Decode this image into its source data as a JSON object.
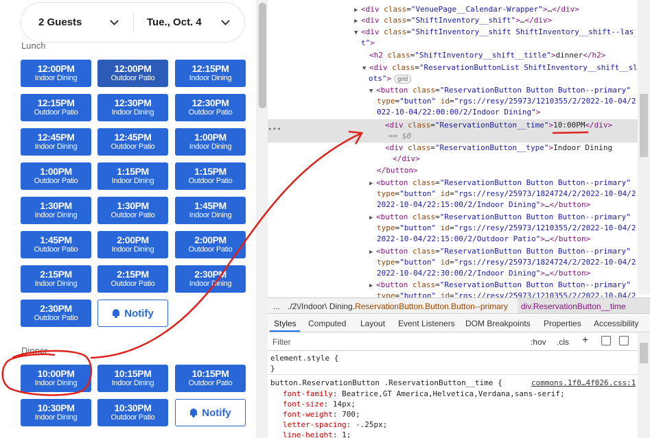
{
  "booking": {
    "guests": "2 Guests",
    "date": "Tue., Oct. 4"
  },
  "lunch": {
    "label": "Lunch",
    "slots": [
      {
        "time": "12:00PM",
        "type": "Indoor Dining"
      },
      {
        "time": "12:00PM",
        "type": "Outdoor Patio"
      },
      {
        "time": "12:15PM",
        "type": "Indoor Dining"
      },
      {
        "time": "12:15PM",
        "type": "Outdoor Patio"
      },
      {
        "time": "12:30PM",
        "type": "Indoor Dining"
      },
      {
        "time": "12:30PM",
        "type": "Outdoor Patio"
      },
      {
        "time": "12:45PM",
        "type": "Indoor Dining"
      },
      {
        "time": "12:45PM",
        "type": "Outdoor Patio"
      },
      {
        "time": "1:00PM",
        "type": "Indoor Dining"
      },
      {
        "time": "1:00PM",
        "type": "Outdoor Patio"
      },
      {
        "time": "1:15PM",
        "type": "Indoor Dining"
      },
      {
        "time": "1:15PM",
        "type": "Outdoor Patio"
      },
      {
        "time": "1:30PM",
        "type": "Indoor Dining"
      },
      {
        "time": "1:30PM",
        "type": "Outdoor Patio"
      },
      {
        "time": "1:45PM",
        "type": "Indoor Dining"
      },
      {
        "time": "1:45PM",
        "type": "Outdoor Patio"
      },
      {
        "time": "2:00PM",
        "type": "Indoor Dining"
      },
      {
        "time": "2:00PM",
        "type": "Outdoor Patio"
      },
      {
        "time": "2:15PM",
        "type": "Indoor Dining"
      },
      {
        "time": "2:15PM",
        "type": "Outdoor Patio"
      },
      {
        "time": "2:30PM",
        "type": "Indoor Dining"
      },
      {
        "time": "2:30PM",
        "type": "Outdoor Patio"
      }
    ],
    "notify_label": "Notify"
  },
  "dinner": {
    "label": "Dinner",
    "slots": [
      {
        "time": "10:00PM",
        "type": "Indoor Dining"
      },
      {
        "time": "10:15PM",
        "type": "Indoor Dining"
      },
      {
        "time": "10:15PM",
        "type": "Outdoor Patio"
      },
      {
        "time": "10:30PM",
        "type": "Indoor Dining"
      },
      {
        "time": "10:30PM",
        "type": "Outdoor Patio"
      }
    ],
    "notify_label": "Notify"
  },
  "dom": {
    "l1": "\"VenuePage__Calendar-Wrapper\"",
    "l2": "\"ShiftInventory__shift\"",
    "l3a": "\"ShiftInventory__shift ShiftInventory__shift--las",
    "l3b": "t\"",
    "l4_cls": "\"ShiftInventory__shift__title\"",
    "l4_text": "dinner",
    "l5a": "\"ReservationButtonList ShiftInventory__shift__sl",
    "l5b": "ots\"",
    "grid": "grid",
    "b1_cls": "\"ReservationButton Button Button--primary\"",
    "b1_type": "\"button\"",
    "b1_id_a": "\"rgs://resy/25973/1210355/2/2022-10-04/2",
    "b1_id_b": "022-10-04/22:00:00/2/Indoor Dining\"",
    "time_cls": "\"ReservationButton__time\"",
    "time_text": "10:00PM",
    "eq": "== $0",
    "type_cls": "\"ReservationButton__type\"",
    "type_text": "Indoor Dining",
    "b2_id_a": "\"rgs://resy/25973/1824724/2/2022-10-04/2",
    "b2_id_b": "2022-10-04/22:15:00/2/Indoor Dining\"",
    "b3_id_a": "\"rgs://resy/25973/1210355/2/2022-10-04/2",
    "b3_id_b": "2022-10-04/22:15:00/2/Outdoor Patio\"",
    "b4_id_a": "\"rgs://resy/25973/1824724/2/2022-10-04/2",
    "b4_id_b": "2022-10-04/22:30:00/2/Indoor Dining\"",
    "b5_id_a": "\"rgs://resy/25973/1210355/2/2022-10-04/2"
  },
  "crumbs": {
    "dots": "...",
    "path": "./2\\/Indoor\\ Dining.",
    "btn": "ReservationButton.Button.Button--primary",
    "cur": "div.ReservationButton__time"
  },
  "tabs": [
    "Styles",
    "Computed",
    "Layout",
    "Event Listeners",
    "DOM Breakpoints",
    "Properties",
    "Accessibility"
  ],
  "filter": {
    "placeholder": "Filter",
    "hov": ":hov",
    "cls": ".cls",
    "plus": "+"
  },
  "styles": {
    "element_style": "element.style {",
    "close": "}",
    "rule_selector": "button.ReservationButton .ReservationButton__time {",
    "rule_source": "commons.1f0…4f026.css:1",
    "props": [
      {
        "name": "font-family",
        "value": "Beatrice,GT America,Helvetica,Verdana,sans-serif;"
      },
      {
        "name": "font-size",
        "value": "14px;"
      },
      {
        "name": "font-weight",
        "value": "700;"
      },
      {
        "name": "letter-spacing",
        "value": "-.25px;"
      },
      {
        "name": "line-height",
        "value": "1;"
      }
    ]
  },
  "colors": {
    "primary": "#2967d8",
    "annotation": "#e0201a"
  }
}
